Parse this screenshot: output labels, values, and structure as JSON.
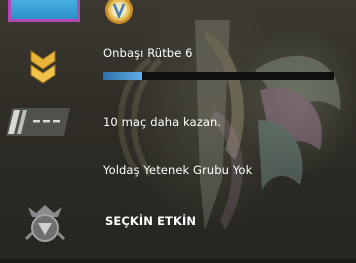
{
  "profile": {
    "rank_name": "Onbaşı Rütbe 6",
    "rank_progress": 0.17,
    "wins_needed_text": "10 maç daha kazan.",
    "skill_group_text": "Yoldaş Yetenek Grubu Yok",
    "elite_label": "SEÇKİN ETKİN"
  },
  "icons": {
    "avatar": "player-avatar",
    "medal": "service-medal-icon",
    "rank": "rank-chevron-icon",
    "skill_group": "unranked-skill-group-icon",
    "elite": "elite-badge-icon",
    "background": "winged-emblem-background"
  },
  "colors": {
    "rank_gold": "#e8b53a",
    "progress_fill": "#4a9bd9",
    "avatar_border": "#b247b6",
    "text": "#ffffff"
  }
}
